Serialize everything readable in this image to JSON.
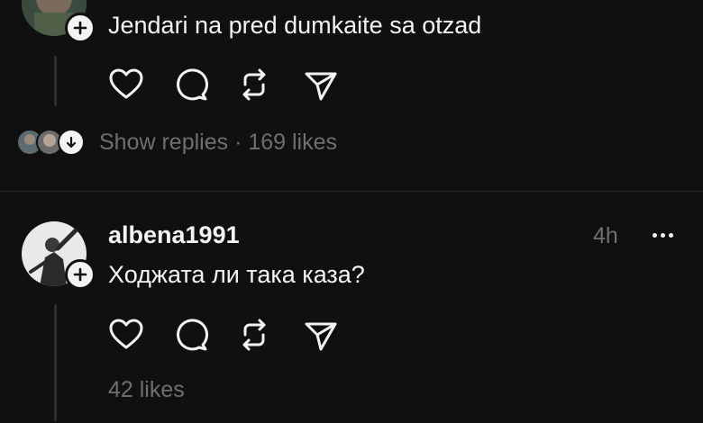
{
  "post1": {
    "text": "Jendari na pred dumkaite sa otzad",
    "replies_label": "Show replies · 169 likes"
  },
  "post2": {
    "username": "albena1991",
    "time": "4h",
    "text": "Ходжата ли така каза?",
    "likes": "42 likes"
  },
  "icons": {
    "like": "heart-icon",
    "comment": "comment-bubble-icon",
    "repost": "repost-icon",
    "share": "send-icon",
    "follow": "plus-icon",
    "more": "more-dots-icon",
    "expand": "chevron-down-icon"
  },
  "colors": {
    "background": "#101010",
    "text": "#f3f3f3",
    "muted": "#6f6f6f",
    "divider": "#2c2c2c"
  }
}
